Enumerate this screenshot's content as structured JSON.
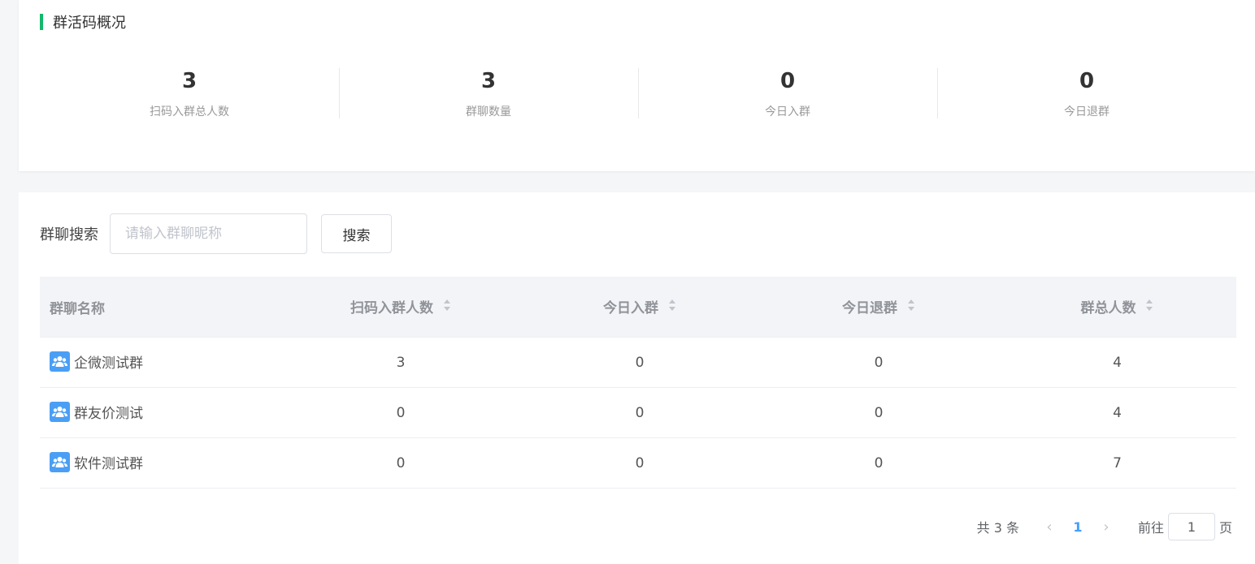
{
  "overview": {
    "title": "群活码概况",
    "stats": [
      {
        "value": "3",
        "label": "扫码入群总人数"
      },
      {
        "value": "3",
        "label": "群聊数量"
      },
      {
        "value": "0",
        "label": "今日入群"
      },
      {
        "value": "0",
        "label": "今日退群"
      }
    ]
  },
  "search": {
    "label": "群聊搜索",
    "placeholder": "请输入群聊昵称",
    "button_label": "搜索"
  },
  "table": {
    "headers": {
      "name": "群聊名称",
      "scan_join": "扫码入群人数",
      "today_join": "今日入群",
      "today_leave": "今日退群",
      "total": "群总人数"
    },
    "rows": [
      {
        "name": "企微测试群",
        "scan_join": "3",
        "today_join": "0",
        "today_leave": "0",
        "total": "4"
      },
      {
        "name": "群友价测试",
        "scan_join": "0",
        "today_join": "0",
        "today_leave": "0",
        "total": "4"
      },
      {
        "name": "软件测试群",
        "scan_join": "0",
        "today_join": "0",
        "today_leave": "0",
        "total": "7"
      }
    ]
  },
  "pagination": {
    "total_text": "共 3 条",
    "current_page": "1",
    "goto_label": "前往",
    "goto_value": "1",
    "page_suffix": "页"
  },
  "colors": {
    "accent_green": "#13b86a",
    "link_blue": "#409eff",
    "icon_blue": "#4a9ff5"
  }
}
